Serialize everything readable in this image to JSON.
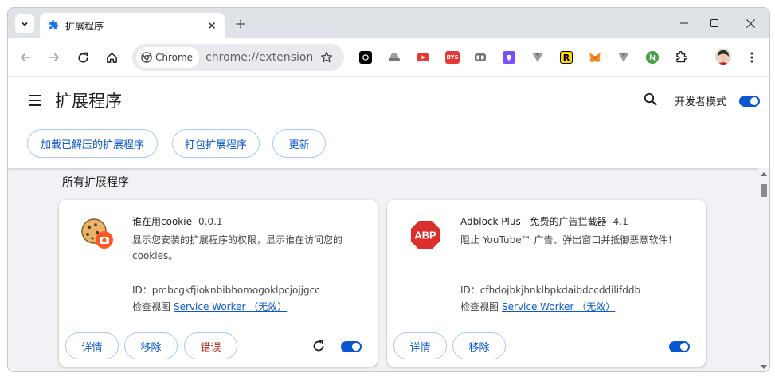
{
  "browser": {
    "tab_title": "扩展程序",
    "omnibox_chip": "Chrome",
    "url": "chrome://extensions",
    "extension_icons": [
      "chatgpt-icon",
      "hat-icon",
      "youtube-icon",
      "bys-icon",
      "bitwarden-icon",
      "shield-icon",
      "vue-icon",
      "reader-icon",
      "metamask-icon",
      "vue-icon",
      "node-icon"
    ],
    "bys_label": "BYS",
    "reader_label": "R"
  },
  "header": {
    "title": "扩展程序",
    "dev_mode_label": "开发者模式",
    "dev_mode_on": true,
    "load_unpacked": "加载已解压的扩展程序",
    "pack": "打包扩展程序",
    "update": "更新"
  },
  "section_title": "所有扩展程序",
  "extensions": [
    {
      "name": "谁在用cookie",
      "version": "0.0.1",
      "description": "显示您安装的扩展程序的权限，显示谁在访问您的cookies。",
      "id_label": "ID：",
      "id": "pmbcgkfjioknbibhomogoklpcjojjgcc",
      "inspect_label": "检查视图",
      "inspect_link": "Service Worker （无效）",
      "details": "详情",
      "remove": "移除",
      "errors": "错误",
      "enabled": true
    },
    {
      "name": "Adblock Plus - 免费的广告拦截器",
      "version": "4.1",
      "description": "阻止 YouTube™ 广告、弹出窗口并抵御恶意软件！",
      "id_label": "ID：",
      "id": "cfhdojbkjhnklbpkdaibdccddilifddb",
      "inspect_label": "检查视图",
      "inspect_link": "Service Worker （无效）",
      "details": "详情",
      "remove": "移除",
      "enabled": true,
      "icon_text": "ABP"
    }
  ],
  "colors": {
    "accent": "#0b57d0",
    "error": "#b3261e",
    "abp_red": "#d9302d"
  }
}
